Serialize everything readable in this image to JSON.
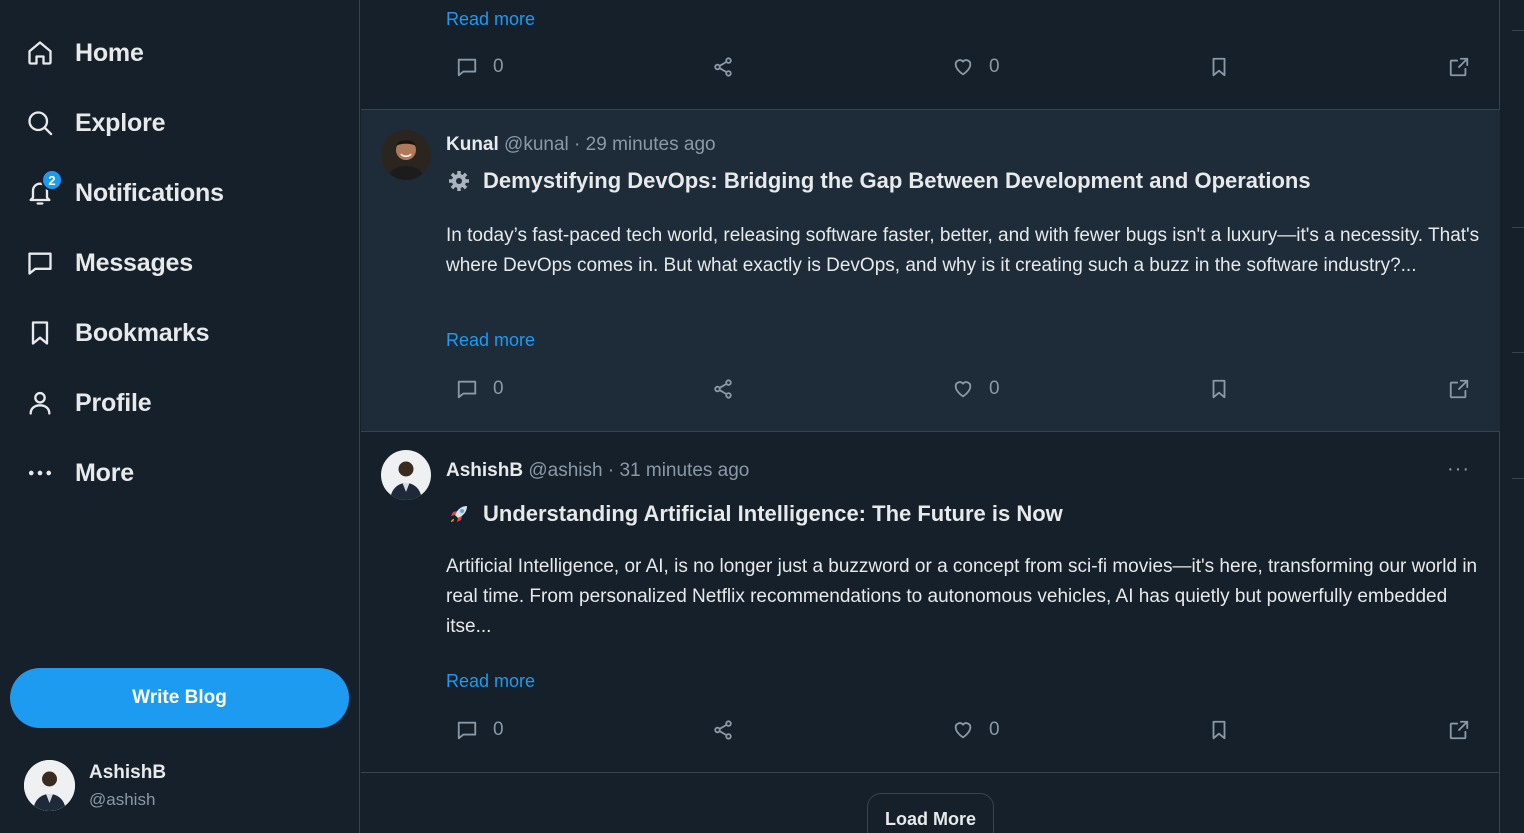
{
  "nav": {
    "items": [
      {
        "label": "Home",
        "icon": "home-icon"
      },
      {
        "label": "Explore",
        "icon": "search-icon"
      },
      {
        "label": "Notifications",
        "icon": "bell-icon",
        "badge": "2"
      },
      {
        "label": "Messages",
        "icon": "message-icon"
      },
      {
        "label": "Bookmarks",
        "icon": "bookmark-icon"
      },
      {
        "label": "Profile",
        "icon": "user-icon"
      },
      {
        "label": "More",
        "icon": "more-dots-icon"
      }
    ],
    "write_label": "Write Blog"
  },
  "account": {
    "name": "AshishB",
    "handle": "@ashish"
  },
  "posts": [
    {
      "read_more": "Read more",
      "comments": "0",
      "likes": "0"
    },
    {
      "author": "Kunal",
      "meta": " @kunal · 29 minutes ago",
      "emoji": "gear",
      "title": "Demystifying DevOps: Bridging the Gap Between Development and Operations",
      "body": "In today’s fast-paced tech world, releasing software faster, better, and with fewer bugs isn't a luxury—it's a necessity. That's where DevOps comes in. But what exactly is DevOps, and why is it creating such a buzz in the software industry?...",
      "read_more": "Read more",
      "comments": "0",
      "likes": "0"
    },
    {
      "author": "AshishB",
      "meta": " @ashish · 31 minutes ago",
      "emoji": "rocket",
      "title": "Understanding Artificial Intelligence: The Future is Now",
      "body": "Artificial Intelligence, or AI, is no longer just a buzzword or a concept from sci-fi movies—it's here, transforming our world in real time. From personalized Netflix recommendations to autonomous vehicles, AI has quietly but powerfully embedded itse...",
      "read_more": "Read more",
      "comments": "0",
      "likes": "0"
    }
  ],
  "more_dots": "···",
  "load_more": "Load More",
  "colors": {
    "background": "#15202b",
    "highlight": "#1e2c3a",
    "accent": "#1d9bf0",
    "muted": "#8b98a5",
    "border": "#38444d"
  }
}
